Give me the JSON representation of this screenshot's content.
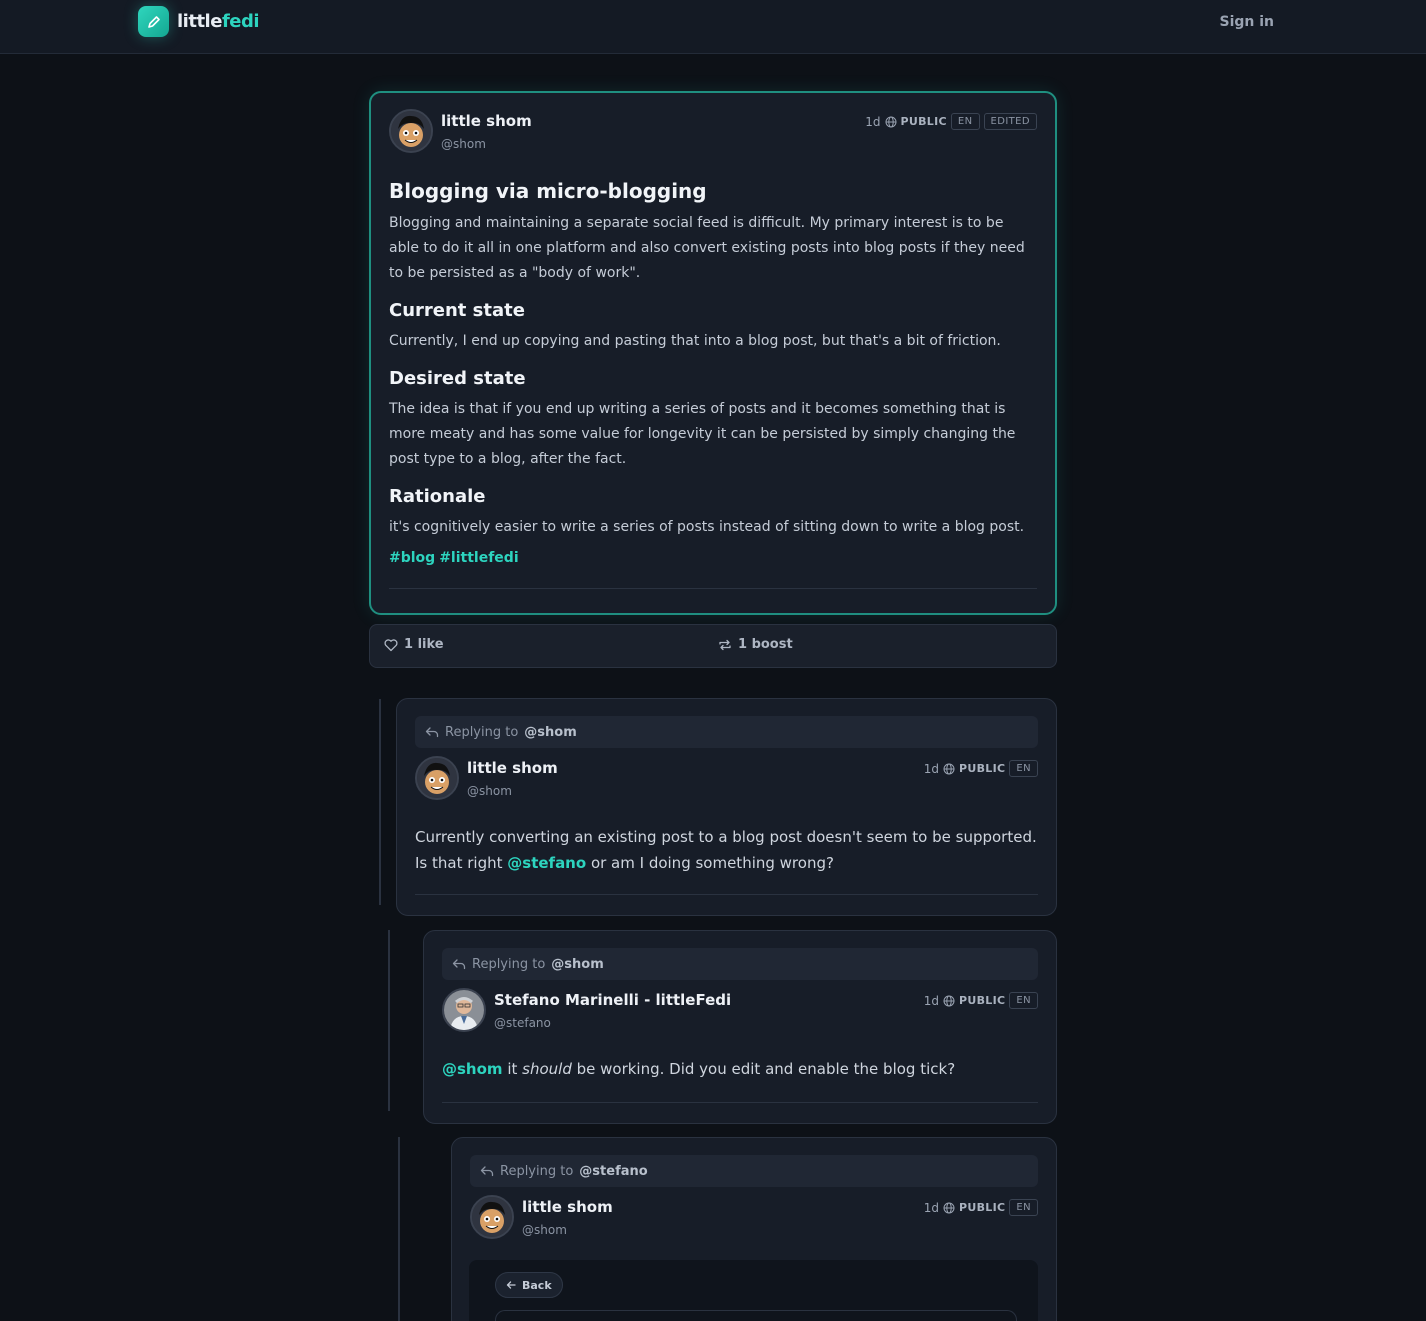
{
  "app": {
    "logo_part1": "little",
    "logo_part2": "fedi",
    "sign_in": "Sign in"
  },
  "main_post": {
    "author": "little shom",
    "handle": "@shom",
    "time": "1d",
    "visibility": "PUBLIC",
    "lang": "EN",
    "edited": "EDITED",
    "title": "Blogging via micro-blogging",
    "intro": "Blogging and maintaining a separate social feed is difficult. My primary interest is to be able to do it all in one platform and also convert existing posts into blog posts if they need to be persisted as a \"body of work\".",
    "h_current": "Current state",
    "p_current": "Currently, I end up copying and pasting that into a blog post, but that's a bit of friction.",
    "h_desired": "Desired state",
    "p_desired": "The idea is that if you end up writing a series of posts and it becomes something that is more meaty and has some value for longevity it can be persisted by simply changing the post type to a blog, after the fact.",
    "h_rationale": "Rationale",
    "p_rationale": "it's cognitively easier to write a series of posts instead of sitting down to write a blog post.",
    "tags": [
      "#blog",
      "#littlefedi"
    ]
  },
  "actions": {
    "likes": "1 like",
    "boosts": "1 boost"
  },
  "replies": [
    {
      "replying_label": "Replying to",
      "replying_to": "@shom",
      "author": "little shom",
      "handle": "@shom",
      "time": "1d",
      "visibility": "PUBLIC",
      "lang": "EN",
      "text_1": "Currently converting an existing post to a blog post doesn't seem to be supported. Is that right",
      "mention": "@stefano",
      "text_2": " or am I doing something wrong?"
    },
    {
      "replying_label": "Replying to",
      "replying_to": "@shom",
      "author": "Stefano Marinelli - littleFedi",
      "handle": "@stefano",
      "time": "1d",
      "visibility": "PUBLIC",
      "lang": "EN",
      "mention": "@shom",
      "text_1": " it ",
      "emph": "should",
      "text_2": " be working. Did you edit and enable the blog tick?"
    },
    {
      "replying_label": "Replying to",
      "replying_to": "@stefano",
      "author": "little shom",
      "handle": "@shom",
      "time": "1d",
      "visibility": "PUBLIC",
      "lang": "EN",
      "back": "Back"
    }
  ],
  "colors": {
    "accent": "#2dd4bf",
    "background": "#0d1117",
    "card": "#171d28"
  }
}
